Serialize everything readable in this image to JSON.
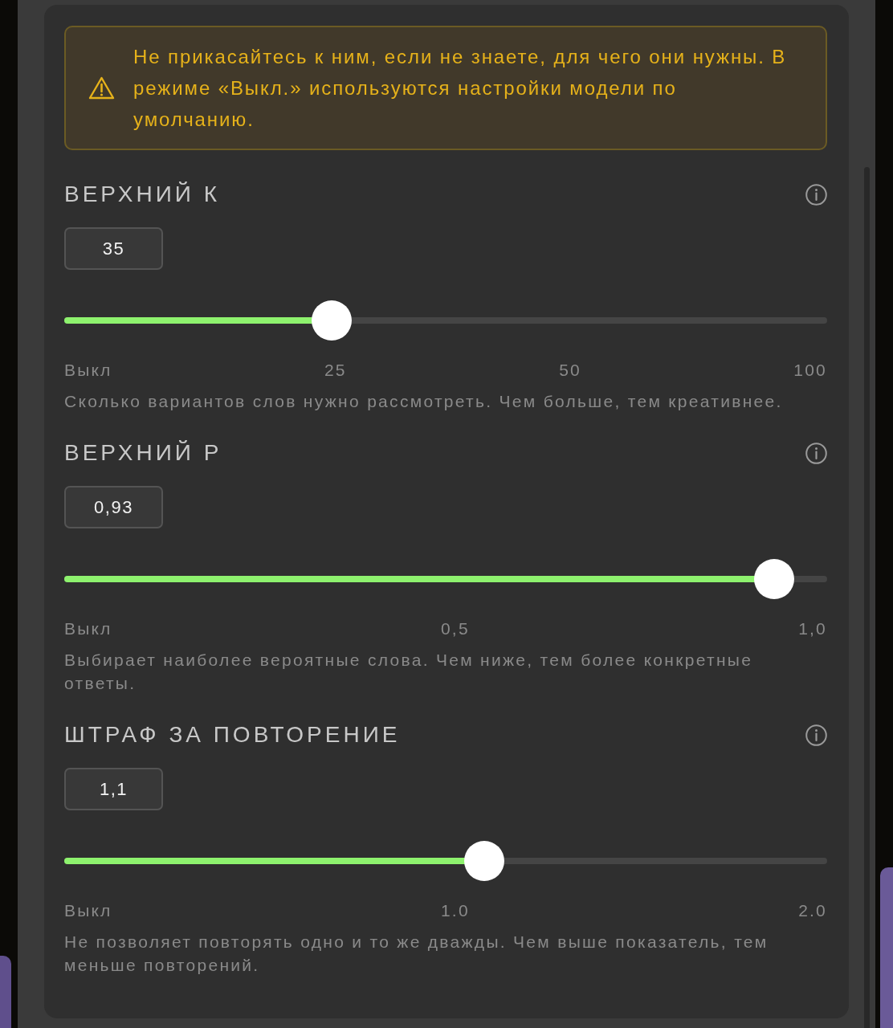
{
  "warning": {
    "text": "Не прикасайтесь к ним, если не знаете, для чего они нужны. В режиме «Выкл.» используются настройки модели по умолчанию."
  },
  "settings": [
    {
      "title": "ВЕРХНИЙ К",
      "value": "35",
      "level": 0.35,
      "ticks": [
        "Выкл",
        "25",
        "50",
        "100"
      ],
      "description": "Сколько вариантов слов нужно рассмотреть. Чем больше, тем креативнее."
    },
    {
      "title": "ВЕРХНИЙ Р",
      "value": "0,93",
      "level": 0.93,
      "ticks": [
        "Выкл",
        "0,5",
        "1,0"
      ],
      "description": "Выбирает наиболее вероятные слова. Чем ниже, тем более конкретные ответы."
    },
    {
      "title": "ШТРАФ ЗА ПОВТОРЕНИЕ",
      "value": "1,1",
      "level": 0.55,
      "ticks": [
        "Выкл",
        "1.0",
        "2.0"
      ],
      "description": "Не позволяет повторять одно и то же дважды. Чем выше показатель, тем меньше повторений."
    }
  ]
}
